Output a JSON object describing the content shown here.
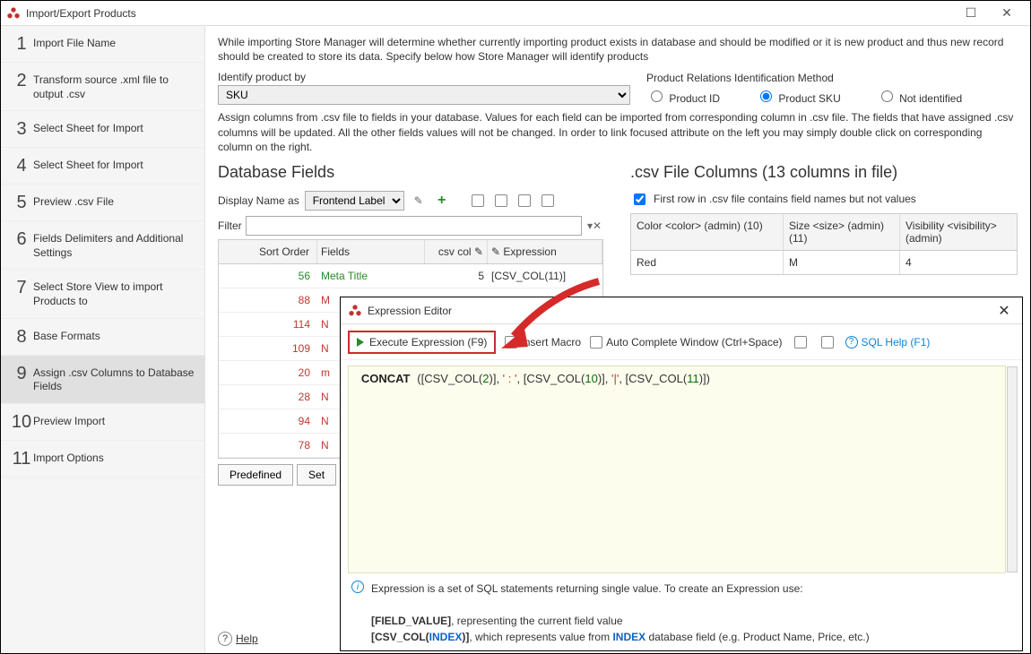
{
  "window": {
    "title": "Import/Export Products",
    "close_glyph": "✕",
    "max_glyph": "☐"
  },
  "sidebar": {
    "steps": [
      {
        "n": "1",
        "label": "Import File Name"
      },
      {
        "n": "2",
        "label": "Transform source .xml file to output .csv"
      },
      {
        "n": "3",
        "label": "Select Sheet for Import"
      },
      {
        "n": "4",
        "label": "Select Sheet for Import"
      },
      {
        "n": "5",
        "label": "Preview .csv File"
      },
      {
        "n": "6",
        "label": "Fields Delimiters and Additional Settings"
      },
      {
        "n": "7",
        "label": "Select Store View to import Products to"
      },
      {
        "n": "8",
        "label": "Base Formats"
      },
      {
        "n": "9",
        "label": "Assign .csv Columns to Database Fields"
      },
      {
        "n": "10",
        "label": "Preview Import"
      },
      {
        "n": "11",
        "label": "Import Options"
      }
    ],
    "active_index": 8
  },
  "main": {
    "intro": "While importing Store Manager will determine whether currently importing product exists in database and should be modified or it is new product and thus new record should be created to store its data. Specify below how Store Manager will identify products",
    "identify_label": "Identify product by",
    "identify_value": "SKU",
    "relations_header": "Product Relations Identification Method",
    "relations_options": [
      {
        "id": "pid",
        "label": "Product ID",
        "checked": false
      },
      {
        "id": "psku",
        "label": "Product SKU",
        "checked": true
      },
      {
        "id": "pnone",
        "label": "Not identified",
        "checked": false
      }
    ],
    "assign_text": "Assign columns from .csv file to fields in your database. Values for each field can be imported from corresponding column in .csv file. The fields that have assigned .csv columns will be updated. All the other fields values will not be changed. In order to link focused attribute on the left you may simply double click on corresponding column on the right.",
    "dbfields": {
      "heading": "Database Fields",
      "display_name_as_label": "Display Name as",
      "display_name_as_value": "Frontend Label",
      "filter_label": "Filter",
      "filter_value": "",
      "col_sort": "Sort Order",
      "col_fields": "Fields",
      "col_csv": "csv col",
      "col_expr": "Expression",
      "rows": [
        {
          "so": "56",
          "field": "Meta Title",
          "csv": "5",
          "expr": "[CSV_COL(11)]",
          "green": true
        },
        {
          "so": "88",
          "field": "M",
          "csv": "",
          "expr": ""
        },
        {
          "so": "114",
          "field": "N",
          "csv": "",
          "expr": ""
        },
        {
          "so": "109",
          "field": "N",
          "csv": "",
          "expr": ""
        },
        {
          "so": "20",
          "field": "m",
          "csv": "",
          "expr": ""
        },
        {
          "so": "28",
          "field": "N",
          "csv": "",
          "expr": ""
        },
        {
          "so": "94",
          "field": "N",
          "csv": "",
          "expr": ""
        },
        {
          "so": "78",
          "field": "N",
          "csv": "",
          "expr": ""
        }
      ],
      "btn_predefined": "Predefined",
      "btn_set": "Set"
    },
    "csv": {
      "heading": ".csv File Columns (13 columns in file)",
      "first_row_label": "First row in .csv file contains field names but not values",
      "first_row_checked": true,
      "headers": [
        "Color <color> (admin) (10)",
        "Size <size> (admin) (11)",
        "Visibility <visibility> (admin)"
      ],
      "row": [
        "Red",
        "M",
        "4"
      ]
    },
    "help_label": "Help"
  },
  "ee": {
    "title": "Expression Editor",
    "exec_label": "Execute Expression (F9)",
    "insert_macro": "Insert Macro",
    "autocomplete": "Auto Complete Window (Ctrl+Space)",
    "sql_help": "SQL Help (F1)",
    "code_tokens": {
      "kw": "CONCAT",
      "p1a": "([CSV_COL(",
      "n1": "2",
      "p1b": ")], ",
      "s1": "' : '",
      "c1": ", [CSV_COL(",
      "n2": "10",
      "p2": ")], ",
      "s2": "'|'",
      "c2": ", [CSV_COL(",
      "n3": "11",
      "p3": ")])"
    },
    "info1": "Expression is a set of SQL statements returning single value. To create an Expression use:",
    "info2a": "[FIELD_VALUE]",
    "info2b": ", representing the current field value",
    "info3a": "[CSV_COL(",
    "info3b": "INDEX",
    "info3c": ")]",
    "info3d": ", which represents value from ",
    "info3e": "INDEX",
    "info3f": " database field (e.g. Product Name, Price, etc.)"
  }
}
